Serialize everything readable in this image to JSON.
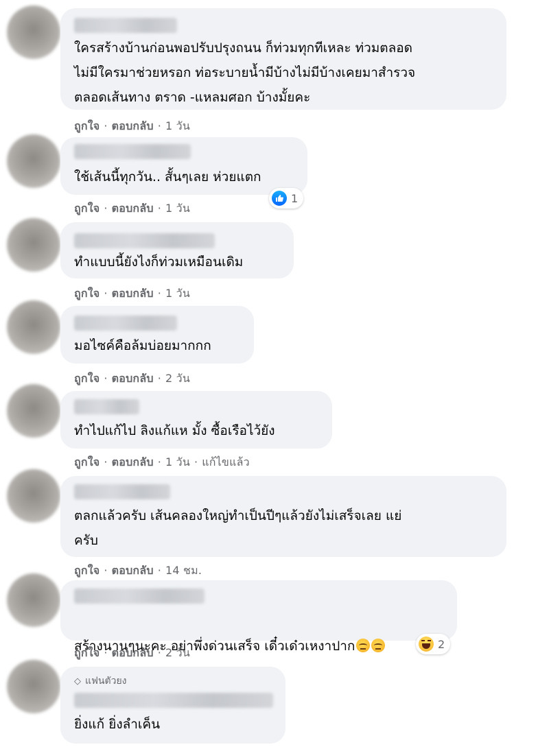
{
  "comments": [
    {
      "text": "ใครสร้างบ้านก่อนพอปรับปรุงถนน ก็ท่วมทุกทีเหละ ท่วมตลอด\nไม่มีใครมาช่วยหรอก ท่อระบายน้ำมีบ้างไม่มีบ้างเคยมาสำรวจ\nตลอดเส้นทาง ตราด -แหลมศอก บ้างมั้ยคะ",
      "like": "ถูกใจ",
      "reply": "ตอบกลับ",
      "time": "1 วัน"
    },
    {
      "text": "ใช้เส้นนี้ทุกวัน.. สั้นๆเลย ห่วยแตก",
      "like": "ถูกใจ",
      "reply": "ตอบกลับ",
      "time": "1 วัน",
      "reaction": {
        "type": "like-icon",
        "count": "1"
      }
    },
    {
      "text": "ทำแบบนี้ยังไงก็ท่วมเหมือนเดิม",
      "like": "ถูกใจ",
      "reply": "ตอบกลับ",
      "time": "1 วัน"
    },
    {
      "text": "มอไซค์คือล้มบ่อยมากกก",
      "like": "ถูกใจ",
      "reply": "ตอบกลับ",
      "time": "2 วัน"
    },
    {
      "text": "ทำไปแก้ไป ลิงแก้แห มั้ง ซื้อเรือไว้ยัง",
      "like": "ถูกใจ",
      "reply": "ตอบกลับ",
      "time": "1 วัน",
      "edited": "แก้ไขแล้ว"
    },
    {
      "text": "ตลกแล้วครับ เส้นคลองใหญ่ทำเป็นปีๆแล้วยังไม่เสร็จเลย แย่\nครับ",
      "like": "ถูกใจ",
      "reply": "ตอบกลับ",
      "time": "14 ชม."
    },
    {
      "text": "สร้างนานๆนะคะ อย่าพึ่งด่วนเสร็จ เดี๋วเด๋วเหงาปาก",
      "like": "ถูกใจ",
      "reply": "ตอบกลับ",
      "time": "2 วัน",
      "text_emojis": [
        "face-with-rolling-eyes",
        "face-with-rolling-eyes"
      ],
      "reaction": {
        "type": "haha-icon",
        "count": "2"
      }
    },
    {
      "badge": "แฟนตัวยง",
      "text": "ยิ่งแก้ ยิ่งลำเค็น"
    }
  ],
  "colors": {
    "bubble": "#f0f2f5",
    "meta": "#65676b",
    "like_blue": "#0866ff"
  }
}
